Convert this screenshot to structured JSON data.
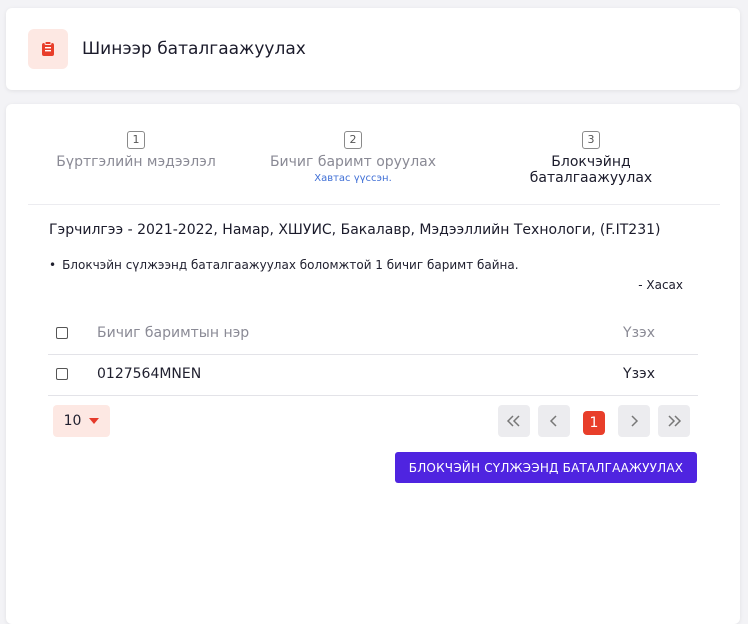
{
  "header": {
    "title": "Шинээр баталгаажуулах",
    "icon": "clipboard-icon"
  },
  "steps": [
    {
      "num": "1",
      "label": "Бүртгэлийн мэдээлэл",
      "sub": ""
    },
    {
      "num": "2",
      "label": "Бичиг баримт оруулах",
      "sub": "Хавтас үүссэн."
    },
    {
      "num": "3",
      "label": "Блокчэйнд баталгаажуулах",
      "sub": ""
    }
  ],
  "course": "Гэрчилгээ - 2021-2022, Намар, ХШУИС, Бакалавр, Мэдээллийн Технологи, (F.IT231)",
  "info": "Блокчэйн сүлжээнд баталгаажуулах боломжтой 1 бичиг баримт байна.",
  "remove_link": "- Хасах",
  "table": {
    "col_name": "Бичиг баримтын нэр",
    "col_action": "Үзэх",
    "rows": [
      {
        "name": "0127564MNEN",
        "action": "Үзэх"
      }
    ]
  },
  "pagination": {
    "page_size": "10",
    "current_page": "1"
  },
  "verify_button": "БЛОКЧЭЙН СҮЛЖЭЭНД БАТАЛГААЖУУЛАХ",
  "colors": {
    "accent": "#e83e2a",
    "primary": "#4f24e0",
    "link": "#3f6fd6"
  }
}
